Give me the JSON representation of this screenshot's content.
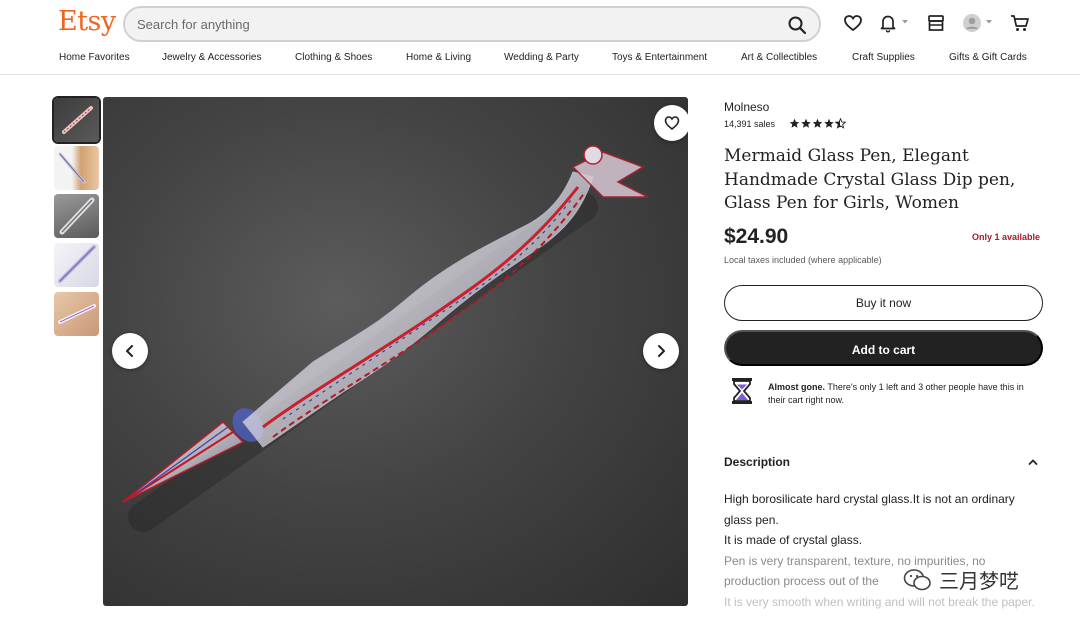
{
  "header": {
    "logo": "Etsy",
    "search_placeholder": "Search for anything",
    "icons": [
      "search-icon",
      "heart-icon",
      "bell-icon",
      "shop-icon",
      "user-avatar-icon",
      "cart-icon"
    ]
  },
  "nav": [
    "Home Favorites",
    "Jewelry & Accessories",
    "Clothing & Shoes",
    "Home & Living",
    "Wedding & Party",
    "Toys & Entertainment",
    "Art & Collectibles",
    "Craft Supplies",
    "Gifts & Gift Cards"
  ],
  "gallery": {
    "thumbnail_count": 5,
    "active_thumbnail": 1
  },
  "listing": {
    "shop_name": "Molneso",
    "sales": "14,391 sales",
    "rating": 4.5,
    "title": "Mermaid Glass Pen, Elegant Handmade Crystal Glass Dip pen, Glass Pen for Girls, Women",
    "price": "$24.90",
    "availability": "Only 1 available",
    "taxes": "Local taxes included (where applicable)",
    "buy_now": "Buy it now",
    "add_to_cart": "Add to cart",
    "almost_gone_bold": "Almost gone.",
    "almost_gone_text": " There's only 1 left and 3 other people have this in their cart right now."
  },
  "description": {
    "heading": "Description",
    "lines": [
      "High borosilicate hard crystal glass.It is not an ordinary glass pen.",
      "It is made of crystal glass.",
      "Pen is very transparent, texture, no impurities, no production process out of the",
      "It is very smooth when writing and will not break the paper."
    ]
  },
  "watermark": "三月梦呓",
  "colors": {
    "brand": "#f1641e",
    "availability": "#a61a2e",
    "primary_button": "#222222"
  }
}
